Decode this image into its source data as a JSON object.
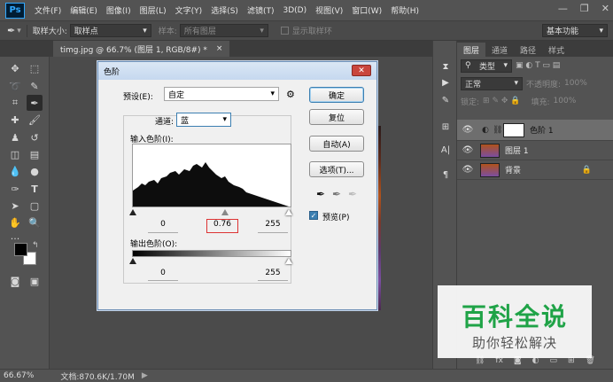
{
  "app": {
    "logo": "Ps"
  },
  "menu": [
    "文件(F)",
    "编辑(E)",
    "图像(I)",
    "图层(L)",
    "文字(Y)",
    "选择(S)",
    "滤镜(T)",
    "3D(D)",
    "视图(V)",
    "窗口(W)",
    "帮助(H)"
  ],
  "window_controls": {
    "minimize": "—",
    "restore": "❐",
    "close": "✕"
  },
  "options_bar": {
    "sample_size_label": "取样大小:",
    "sample_size_value": "取样点",
    "sample_label": "样本:",
    "sample_value": "所有图层",
    "show_ring_label": "显示取样环",
    "workspace": "基本功能"
  },
  "document": {
    "tab_title": "timg.jpg @ 66.7% (图层 1, RGB/8#) *",
    "close": "×"
  },
  "status": {
    "zoom": "66.67%",
    "doc_info": "文档:870.6K/1.70M"
  },
  "levels_dialog": {
    "title": "色阶",
    "preset_label": "预设(E):",
    "preset_value": "自定",
    "channel_label": "通道:",
    "channel_value": "蓝",
    "input_label": "输入色阶(I):",
    "input_values": [
      "0",
      "0.76",
      "255"
    ],
    "output_label": "输出色阶(O):",
    "output_values": [
      "0",
      "255"
    ],
    "buttons": {
      "ok": "确定",
      "reset": "复位",
      "auto": "自动(A)",
      "options": "选项(T)..."
    },
    "preview_label": "预览(P)",
    "preview_checked": true
  },
  "panels": {
    "tabs": [
      "图层",
      "通道",
      "路径",
      "样式"
    ],
    "kind_filter": "类型",
    "blend_mode": "正常",
    "opacity_label": "不透明度:",
    "opacity_value": "100%",
    "lock_label": "锁定:",
    "fill_label": "填充:",
    "fill_value": "100%",
    "layers": [
      {
        "name": "色阶 1",
        "selected": true
      },
      {
        "name": "图层 1",
        "selected": false
      },
      {
        "name": "背景",
        "selected": false
      }
    ]
  },
  "watermark": {
    "title": "百科全说",
    "subtitle": "助你轻松解决"
  },
  "colors": {
    "accent": "#31a8ff",
    "watermark_green": "#1fa347"
  }
}
